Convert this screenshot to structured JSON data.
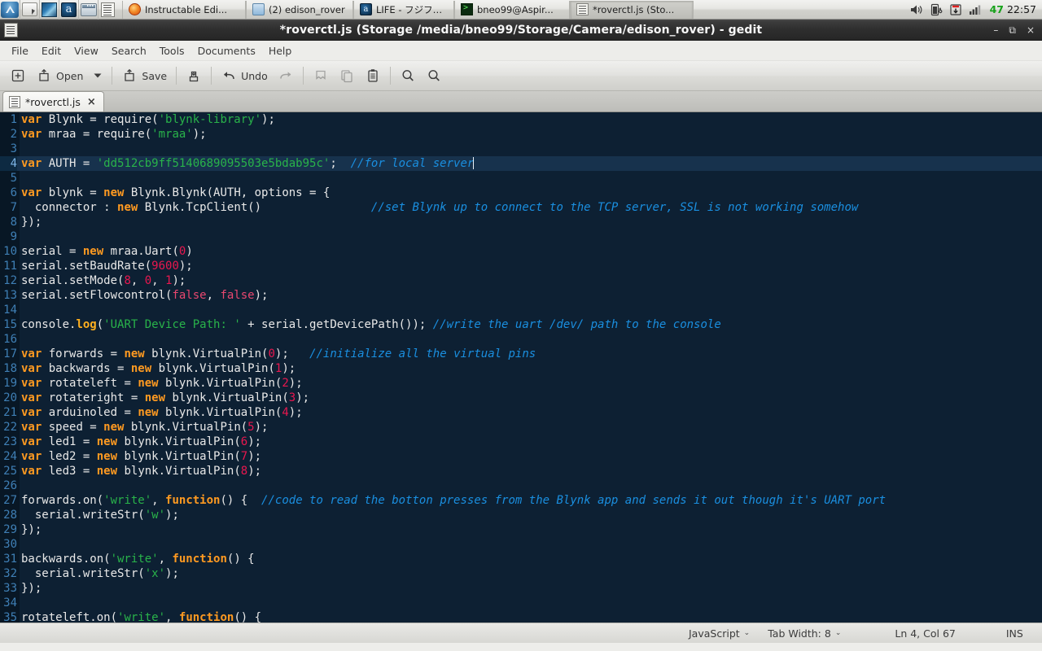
{
  "taskbar": {
    "launchers": [
      {
        "name": "app-menu-icon",
        "kind": "blue-oval"
      },
      {
        "name": "file-manager-icon",
        "kind": "folder"
      },
      {
        "name": "web-browser-icon",
        "kind": "globe"
      },
      {
        "name": "amazon-icon",
        "kind": "amz",
        "glyph": "a"
      },
      {
        "name": "window-list-icon",
        "kind": "window"
      },
      {
        "name": "text-editor-icon",
        "kind": "gedit"
      }
    ],
    "windows": [
      {
        "label": "Instructable Edi...",
        "icon": "firefox",
        "active": false
      },
      {
        "label": "(2) edison_rover",
        "icon": "folder",
        "active": false
      },
      {
        "label": "LIFE - フジファ...",
        "icon": "amz",
        "active": false
      },
      {
        "label": "bneo99@Aspir...",
        "icon": "term",
        "active": false
      },
      {
        "label": "*roverctl.js (Sto...",
        "icon": "gedit",
        "active": true
      }
    ],
    "tray": {
      "volume_icon": "speaker-icon",
      "battery_icon": "battery-charging-icon",
      "update_icon": "software-update-icon",
      "network_icon": "signal-bars-icon",
      "battery_percent": "47",
      "clock": "22:57"
    }
  },
  "window": {
    "title": "*roverctl.js (Storage /media/bneo99/Storage/Camera/edison_rover) - gedit",
    "controls": {
      "minimize": "–",
      "maximize": "⧉",
      "close": "×"
    }
  },
  "menubar": {
    "items": [
      "File",
      "Edit",
      "View",
      "Search",
      "Tools",
      "Documents",
      "Help"
    ]
  },
  "toolbar": {
    "new_label": "",
    "open_label": "Open",
    "save_label": "Save",
    "undo_label": "Undo",
    "buttons": [
      {
        "name": "new-document-button",
        "icon": "plus-box-icon",
        "label": ""
      },
      {
        "name": "open-button",
        "icon": "open-folder-icon",
        "label": "Open"
      },
      {
        "name": "open-dropdown-button",
        "icon": "chevron-down-icon",
        "label": ""
      },
      {
        "name": "save-button",
        "icon": "save-icon",
        "label": "Save"
      },
      {
        "name": "print-button",
        "icon": "print-icon",
        "label": ""
      },
      {
        "name": "undo-button",
        "icon": "undo-arrow-icon",
        "label": "Undo"
      },
      {
        "name": "redo-button",
        "icon": "redo-arrow-icon",
        "label": ""
      },
      {
        "name": "cut-button",
        "icon": "cut-icon",
        "label": ""
      },
      {
        "name": "copy-button",
        "icon": "copy-icon",
        "label": ""
      },
      {
        "name": "paste-button",
        "icon": "paste-clipboard-icon",
        "label": ""
      },
      {
        "name": "find-button",
        "icon": "magnifier-icon",
        "label": ""
      },
      {
        "name": "find-replace-button",
        "icon": "magnifier-replace-icon",
        "label": ""
      }
    ]
  },
  "tab": {
    "label": "*roverctl.js",
    "close_label": "×",
    "icon": "document-icon"
  },
  "statusbar": {
    "language": "JavaScript",
    "tab_width": "Tab Width: 8",
    "position": "Ln 4, Col 67",
    "insert_mode": "INS",
    "chevron": "⌄"
  },
  "editor": {
    "current_line": 4,
    "colors": {
      "background": "#0d2033",
      "gutter": "#081725",
      "current_line_bg": "#17324d",
      "keyword": "#ff9a21",
      "string": "#29b34a",
      "comment": "#1a8fe0",
      "number": "#e8174f",
      "function": "#ffb01f",
      "text": "#e8e8e8",
      "line_number": "#3f7fb5"
    },
    "lines": [
      {
        "n": 1,
        "tokens": [
          {
            "t": "var",
            "c": "kw"
          },
          {
            "t": " Blynk = require("
          },
          {
            "t": "'blynk-library'",
            "c": "str"
          },
          {
            "t": ");"
          }
        ]
      },
      {
        "n": 2,
        "tokens": [
          {
            "t": "var",
            "c": "kw"
          },
          {
            "t": " mraa = require("
          },
          {
            "t": "'mraa'",
            "c": "str"
          },
          {
            "t": ");"
          }
        ]
      },
      {
        "n": 3,
        "tokens": []
      },
      {
        "n": 4,
        "tokens": [
          {
            "t": "var",
            "c": "kw"
          },
          {
            "t": " AUTH = "
          },
          {
            "t": "'dd512cb9ff5140689095503e5bdab95c'",
            "c": "str"
          },
          {
            "t": ";  "
          },
          {
            "t": "//for local server",
            "c": "com"
          },
          {
            "t": "",
            "c": "cursor"
          }
        ]
      },
      {
        "n": 5,
        "tokens": []
      },
      {
        "n": 6,
        "tokens": [
          {
            "t": "var",
            "c": "kw"
          },
          {
            "t": " blynk = "
          },
          {
            "t": "new",
            "c": "kw"
          },
          {
            "t": " Blynk.Blynk(AUTH, options = {"
          }
        ]
      },
      {
        "n": 7,
        "tokens": [
          {
            "t": "  connector : "
          },
          {
            "t": "new",
            "c": "kw"
          },
          {
            "t": " Blynk.TcpClient()                "
          },
          {
            "t": "//set Blynk up to connect to the TCP server, SSL is not working somehow",
            "c": "com"
          }
        ]
      },
      {
        "n": 8,
        "tokens": [
          {
            "t": "});"
          }
        ]
      },
      {
        "n": 9,
        "tokens": []
      },
      {
        "n": 10,
        "tokens": [
          {
            "t": "serial = "
          },
          {
            "t": "new",
            "c": "kw"
          },
          {
            "t": " mraa.Uart("
          },
          {
            "t": "0",
            "c": "num"
          },
          {
            "t": ")"
          }
        ]
      },
      {
        "n": 11,
        "tokens": [
          {
            "t": "serial.setBaudRate("
          },
          {
            "t": "9600",
            "c": "num"
          },
          {
            "t": ");"
          }
        ]
      },
      {
        "n": 12,
        "tokens": [
          {
            "t": "serial.setMode("
          },
          {
            "t": "8",
            "c": "num"
          },
          {
            "t": ", "
          },
          {
            "t": "0",
            "c": "num"
          },
          {
            "t": ", "
          },
          {
            "t": "1",
            "c": "num"
          },
          {
            "t": ");"
          }
        ]
      },
      {
        "n": 13,
        "tokens": [
          {
            "t": "serial.setFlowcontrol("
          },
          {
            "t": "false",
            "c": "bool"
          },
          {
            "t": ", "
          },
          {
            "t": "false",
            "c": "bool"
          },
          {
            "t": ");"
          }
        ]
      },
      {
        "n": 14,
        "tokens": []
      },
      {
        "n": 15,
        "tokens": [
          {
            "t": "console."
          },
          {
            "t": "log",
            "c": "fn"
          },
          {
            "t": "("
          },
          {
            "t": "'UART Device Path: '",
            "c": "str"
          },
          {
            "t": " + serial.getDevicePath()); "
          },
          {
            "t": "//write the uart /dev/ path to the console",
            "c": "com"
          }
        ]
      },
      {
        "n": 16,
        "tokens": []
      },
      {
        "n": 17,
        "tokens": [
          {
            "t": "var",
            "c": "kw"
          },
          {
            "t": " forwards = "
          },
          {
            "t": "new",
            "c": "kw"
          },
          {
            "t": " blynk.VirtualPin("
          },
          {
            "t": "0",
            "c": "num"
          },
          {
            "t": ");   "
          },
          {
            "t": "//initialize all the virtual pins",
            "c": "com"
          }
        ]
      },
      {
        "n": 18,
        "tokens": [
          {
            "t": "var",
            "c": "kw"
          },
          {
            "t": " backwards = "
          },
          {
            "t": "new",
            "c": "kw"
          },
          {
            "t": " blynk.VirtualPin("
          },
          {
            "t": "1",
            "c": "num"
          },
          {
            "t": ");"
          }
        ]
      },
      {
        "n": 19,
        "tokens": [
          {
            "t": "var",
            "c": "kw"
          },
          {
            "t": " rotateleft = "
          },
          {
            "t": "new",
            "c": "kw"
          },
          {
            "t": " blynk.VirtualPin("
          },
          {
            "t": "2",
            "c": "num"
          },
          {
            "t": ");"
          }
        ]
      },
      {
        "n": 20,
        "tokens": [
          {
            "t": "var",
            "c": "kw"
          },
          {
            "t": " rotateright = "
          },
          {
            "t": "new",
            "c": "kw"
          },
          {
            "t": " blynk.VirtualPin("
          },
          {
            "t": "3",
            "c": "num"
          },
          {
            "t": ");"
          }
        ]
      },
      {
        "n": 21,
        "tokens": [
          {
            "t": "var",
            "c": "kw"
          },
          {
            "t": " arduinoled = "
          },
          {
            "t": "new",
            "c": "kw"
          },
          {
            "t": " blynk.VirtualPin("
          },
          {
            "t": "4",
            "c": "num"
          },
          {
            "t": ");"
          }
        ]
      },
      {
        "n": 22,
        "tokens": [
          {
            "t": "var",
            "c": "kw"
          },
          {
            "t": " speed = "
          },
          {
            "t": "new",
            "c": "kw"
          },
          {
            "t": " blynk.VirtualPin("
          },
          {
            "t": "5",
            "c": "num"
          },
          {
            "t": ");"
          }
        ]
      },
      {
        "n": 23,
        "tokens": [
          {
            "t": "var",
            "c": "kw"
          },
          {
            "t": " led1 = "
          },
          {
            "t": "new",
            "c": "kw"
          },
          {
            "t": " blynk.VirtualPin("
          },
          {
            "t": "6",
            "c": "num"
          },
          {
            "t": ");"
          }
        ]
      },
      {
        "n": 24,
        "tokens": [
          {
            "t": "var",
            "c": "kw"
          },
          {
            "t": " led2 = "
          },
          {
            "t": "new",
            "c": "kw"
          },
          {
            "t": " blynk.VirtualPin("
          },
          {
            "t": "7",
            "c": "num"
          },
          {
            "t": ");"
          }
        ]
      },
      {
        "n": 25,
        "tokens": [
          {
            "t": "var",
            "c": "kw"
          },
          {
            "t": " led3 = "
          },
          {
            "t": "new",
            "c": "kw"
          },
          {
            "t": " blynk.VirtualPin("
          },
          {
            "t": "8",
            "c": "num"
          },
          {
            "t": ");"
          }
        ]
      },
      {
        "n": 26,
        "tokens": []
      },
      {
        "n": 27,
        "tokens": [
          {
            "t": "forwards.on("
          },
          {
            "t": "'write'",
            "c": "str"
          },
          {
            "t": ", "
          },
          {
            "t": "function",
            "c": "kw"
          },
          {
            "t": "() {  "
          },
          {
            "t": "//code to read the botton presses from the Blynk app and sends it out though it's UART port",
            "c": "com"
          }
        ]
      },
      {
        "n": 28,
        "tokens": [
          {
            "t": "  serial.writeStr("
          },
          {
            "t": "'w'",
            "c": "str"
          },
          {
            "t": ");"
          }
        ]
      },
      {
        "n": 29,
        "tokens": [
          {
            "t": "});"
          }
        ]
      },
      {
        "n": 30,
        "tokens": []
      },
      {
        "n": 31,
        "tokens": [
          {
            "t": "backwards.on("
          },
          {
            "t": "'write'",
            "c": "str"
          },
          {
            "t": ", "
          },
          {
            "t": "function",
            "c": "kw"
          },
          {
            "t": "() {"
          }
        ]
      },
      {
        "n": 32,
        "tokens": [
          {
            "t": "  serial.writeStr("
          },
          {
            "t": "'x'",
            "c": "str"
          },
          {
            "t": ");"
          }
        ]
      },
      {
        "n": 33,
        "tokens": [
          {
            "t": "});"
          }
        ]
      },
      {
        "n": 34,
        "tokens": []
      },
      {
        "n": 35,
        "tokens": [
          {
            "t": "rotateleft.on("
          },
          {
            "t": "'write'",
            "c": "str"
          },
          {
            "t": ", "
          },
          {
            "t": "function",
            "c": "kw"
          },
          {
            "t": "() {"
          }
        ]
      }
    ]
  }
}
